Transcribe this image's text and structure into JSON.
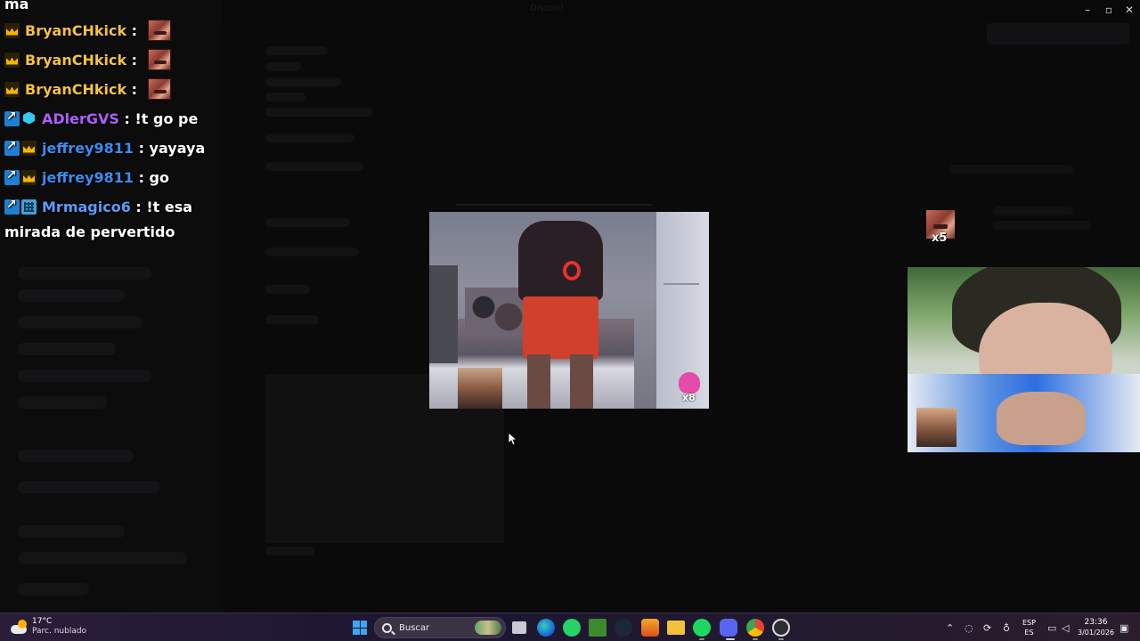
{
  "window": {
    "title": "Discord"
  },
  "chat": {
    "partial_top_line": "ma",
    "messages": [
      {
        "badges": [
          "crown"
        ],
        "user": "BryanCHkick",
        "user_color": "#F5C242",
        "text": "",
        "emote": true
      },
      {
        "badges": [
          "crown"
        ],
        "user": "BryanCHkick",
        "user_color": "#F5C242",
        "text": "",
        "emote": true
      },
      {
        "badges": [
          "crown"
        ],
        "user": "BryanCHkick",
        "user_color": "#F5C242",
        "text": "",
        "emote": true
      },
      {
        "badges": [
          "prime",
          "cube"
        ],
        "user": "ADlerGVS",
        "user_color": "#B15DFF",
        "text": "!t go pe",
        "emote": false
      },
      {
        "badges": [
          "prime",
          "crown"
        ],
        "user": "jeffrey9811",
        "user_color": "#3C8CF0",
        "text": "yayaya",
        "emote": false
      },
      {
        "badges": [
          "prime",
          "crown"
        ],
        "user": "jeffrey9811",
        "user_color": "#3C8CF0",
        "text": "go",
        "emote": false
      },
      {
        "badges": [
          "prime",
          "grid"
        ],
        "user": "Mrmagico6",
        "user_color": "#5B9BF5",
        "text": "!t esa",
        "emote": false
      }
    ],
    "continuation": "mirada de pervertido",
    "separator": " : "
  },
  "center_video": {
    "reaction_count": "x8"
  },
  "floating_emote": {
    "count": "x5"
  },
  "taskbar": {
    "weather": {
      "temp": "17°C",
      "desc": "Parc. nublado"
    },
    "search_placeholder": "Buscar",
    "apps": [
      "file-explorer-icon",
      "edge-icon",
      "whatsapp-icon",
      "minecraft-icon",
      "steam-icon",
      "app-a-icon",
      "folder-icon",
      "spotify-icon",
      "discord-icon",
      "chrome-icon",
      "obs-icon"
    ],
    "language": {
      "top": "ESP",
      "bottom": "ES"
    },
    "clock": {
      "time": "23:36",
      "date": "3/01/2026"
    },
    "colors": {
      "accent": "#3CA6F2"
    }
  }
}
